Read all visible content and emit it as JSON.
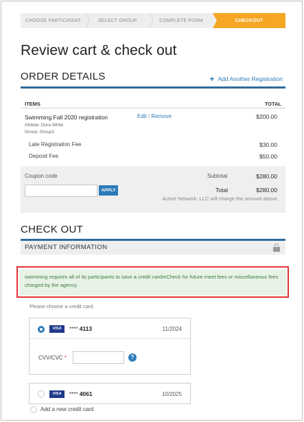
{
  "steps": [
    "CHOOSE PARTICIPANT",
    "SELECT GROUP",
    "COMPLETE FORM",
    "CHECKOUT"
  ],
  "page_title": "Review cart & check out",
  "order": {
    "heading": "ORDER DETAILS",
    "add_registration": "Add Another Registration",
    "items_label": "ITEMS",
    "total_label": "TOTAL",
    "item": {
      "name": "Swimming Fall 2020 registration",
      "athlete": "Athlete: Dora White",
      "group": "Group: Group1",
      "edit": "Edit",
      "separator": "|",
      "remove": "Remove",
      "price": "$200.00"
    },
    "fees": [
      {
        "name": "Late Registration Fee",
        "price": "$30.00"
      },
      {
        "name": "Deposit Fee",
        "price": "$50.00"
      }
    ],
    "coupon_label": "Coupon code",
    "coupon_value": "",
    "apply_label": "APPLY",
    "subtotal_label": "Subtotal",
    "subtotal_value": "$280.00",
    "total_text": "Total",
    "total_value": "$280.00",
    "charge_note": "Active Network, LLC will charge the amount above"
  },
  "checkout": {
    "heading": "CHECK OUT",
    "payment_info": "PAYMENT INFORMATION",
    "alert": "swimming requires all of its participants to save a credit card/eCheck for future meet fees or miscellaneous fees charged by the agency.",
    "choose_label": "Please choose a credit card.",
    "cards": [
      {
        "brand": "VISA",
        "mask": "****",
        "last4": "4113",
        "expiry": "11/2024",
        "selected": true
      },
      {
        "brand": "VISA",
        "mask": "****",
        "last4": "4061",
        "expiry": "10/2025",
        "selected": false
      }
    ],
    "cvv_label": "CVV/CVC",
    "cvv_required": "*",
    "cvv_value": "",
    "help": "?",
    "add_card": "Add a new credit card"
  },
  "colors": {
    "accent": "#2b7bb9",
    "active_step": "#f5a623",
    "section_rule": "#2f6c9c",
    "alert_border": "#e03333",
    "alert_bg": "#e8f3e8",
    "alert_text": "#3e7b3e"
  },
  "icons": {
    "add": "plus-icon",
    "lock": "lock-icon",
    "help": "question-icon",
    "card_brand": "visa-icon"
  }
}
